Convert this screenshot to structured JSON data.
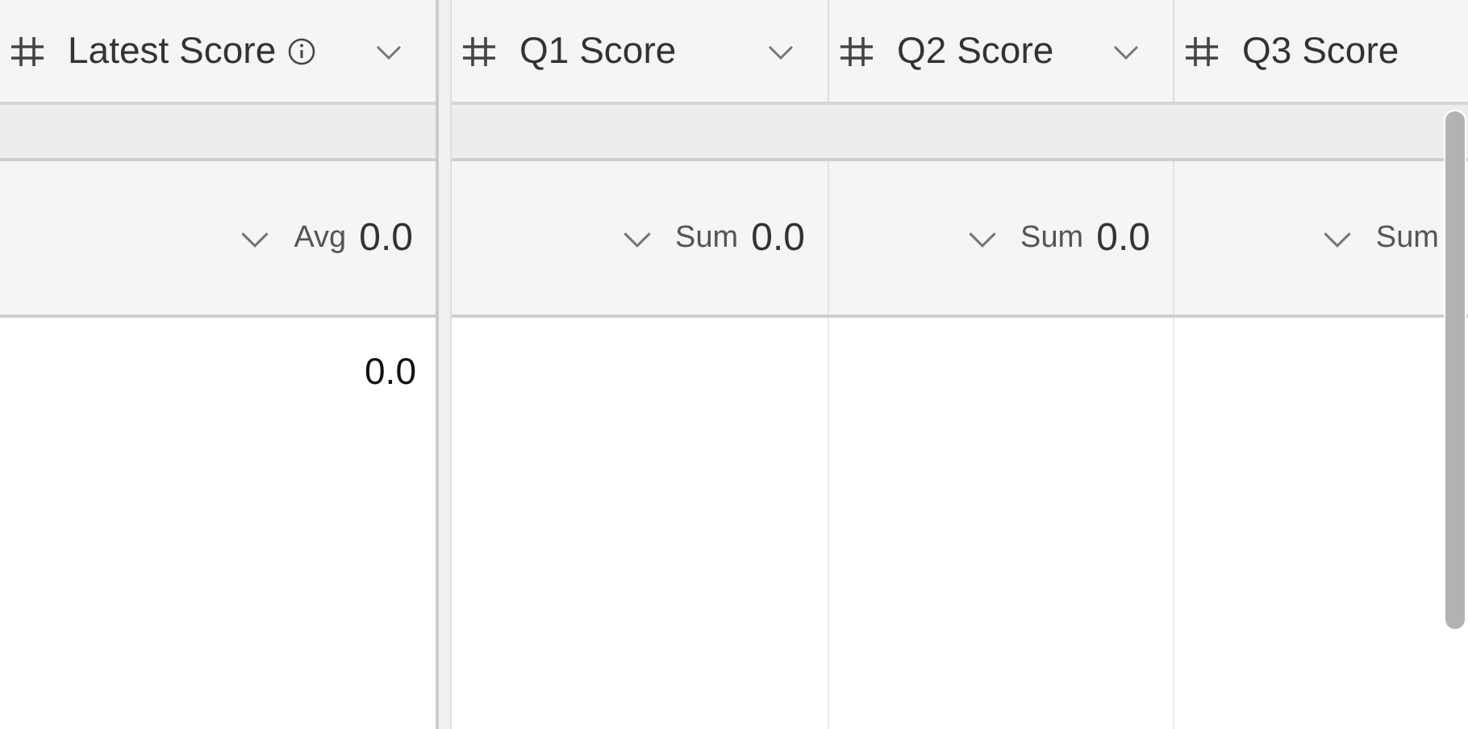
{
  "columns": [
    {
      "name": "Latest Score",
      "info": true,
      "menu": true,
      "summary": {
        "function": "Avg",
        "value": "0.0"
      }
    },
    {
      "name": "Q1 Score",
      "info": false,
      "menu": true,
      "summary": {
        "function": "Sum",
        "value": "0.0"
      }
    },
    {
      "name": "Q2 Score",
      "info": false,
      "menu": true,
      "summary": {
        "function": "Sum",
        "value": "0.0"
      }
    },
    {
      "name": "Q3 Score",
      "info": false,
      "menu": false,
      "summary": {
        "function": "Sum"
      }
    }
  ],
  "rows": [
    [
      "0.0"
    ]
  ]
}
